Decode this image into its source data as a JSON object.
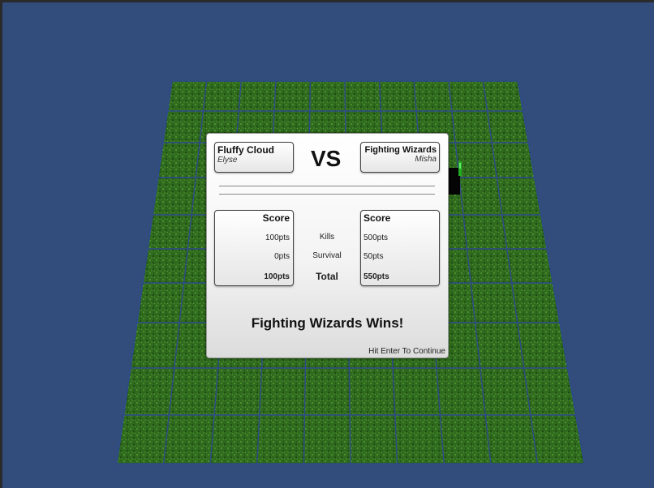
{
  "scene": {
    "background_color": "#324d7c",
    "grass_color": "#2f6a1e",
    "grid_line_color": "#2e4a8a"
  },
  "match": {
    "vs_label": "VS",
    "player_left": {
      "name": "Fluffy Cloud",
      "wizard": "Elyse"
    },
    "player_right": {
      "name": "Fighting Wizards",
      "wizard": "Misha"
    }
  },
  "scores": {
    "title": "Score",
    "rows": [
      "Kills",
      "Survival",
      "Total"
    ],
    "left": {
      "kills": "100pts",
      "survival": "0pts",
      "total": "100pts"
    },
    "right": {
      "kills": "500pts",
      "survival": "50pts",
      "total": "550pts"
    }
  },
  "result": {
    "winner_text": "Fighting Wizards Wins!",
    "continue_hint": "Hit Enter To Continue"
  }
}
